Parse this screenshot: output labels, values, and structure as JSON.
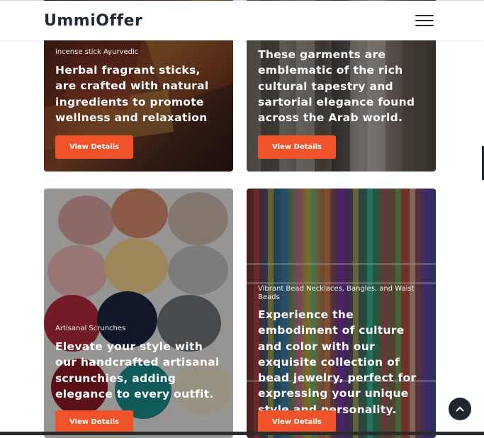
{
  "header": {
    "logo": "UmmiOffer",
    "menu_icon": "hamburger-menu-icon"
  },
  "cards": [
    {
      "category": "incense stick Ayurvedic",
      "description": "Herbal fragrant sticks, are crafted with natural ingredients to promote wellness and relaxation",
      "button": "View Details"
    },
    {
      "category": "",
      "description": "These garments are emblematic of the rich cultural tapestry and sartorial elegance found across the Arab world.",
      "button": "View Details"
    },
    {
      "category": "Artisanal Scrunches",
      "description": "Elevate your style with our handcrafted artisanal scrunchies, adding elegance to every outfit.",
      "button": "View Details"
    },
    {
      "category": "Vibrant Bead Necklaces, Bangles, and Waist Beads",
      "description": "Experience the embodiment of culture and color with our exquisite collection of bead jewelry, perfect for expressing your unique style and personality.",
      "button": "View Details"
    }
  ],
  "scroll_top_icon": "chevron-up-icon",
  "colors": {
    "button": "#f0522a",
    "logo": "#1e2a36",
    "scroll_top_bg": "#1f262c"
  }
}
